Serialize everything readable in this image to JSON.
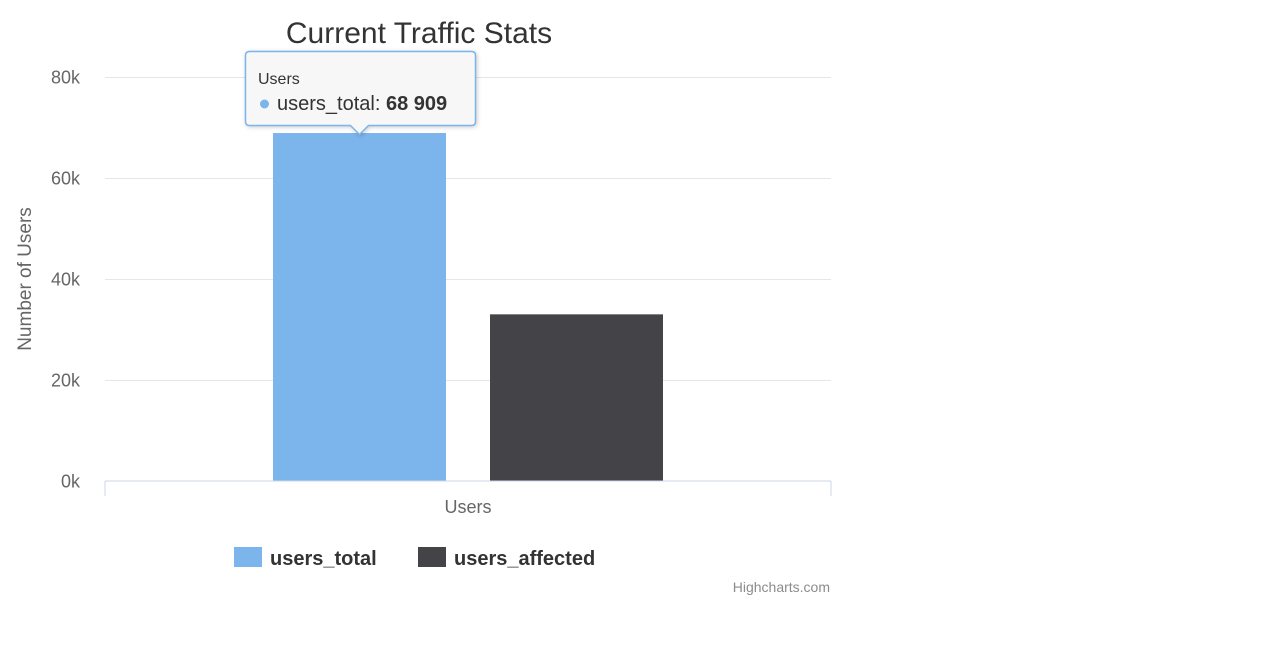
{
  "chart_data": {
    "type": "bar",
    "title": "Current Traffic Stats",
    "xlabel": "",
    "ylabel": "Number of Users",
    "categories": [
      "Users"
    ],
    "series": [
      {
        "name": "users_total",
        "values": [
          68909
        ],
        "color": "#7cb5ec"
      },
      {
        "name": "users_affected",
        "values": [
          33000
        ],
        "color": "#434348"
      }
    ],
    "ylim": [
      0,
      80000
    ],
    "yticks": [
      0,
      20000,
      40000,
      60000,
      80000
    ],
    "ytick_labels": [
      "0k",
      "20k",
      "40k",
      "60k",
      "80k"
    ],
    "grid": true,
    "legend_position": "bottom"
  },
  "tooltip": {
    "header": "Users",
    "series_name": "users_total",
    "value_text": "68 909"
  },
  "credits": "Highcharts.com",
  "colors": {
    "grid": "#e6e6e6",
    "axis": "#ccd6eb",
    "text": "#333333",
    "label": "#666666"
  }
}
